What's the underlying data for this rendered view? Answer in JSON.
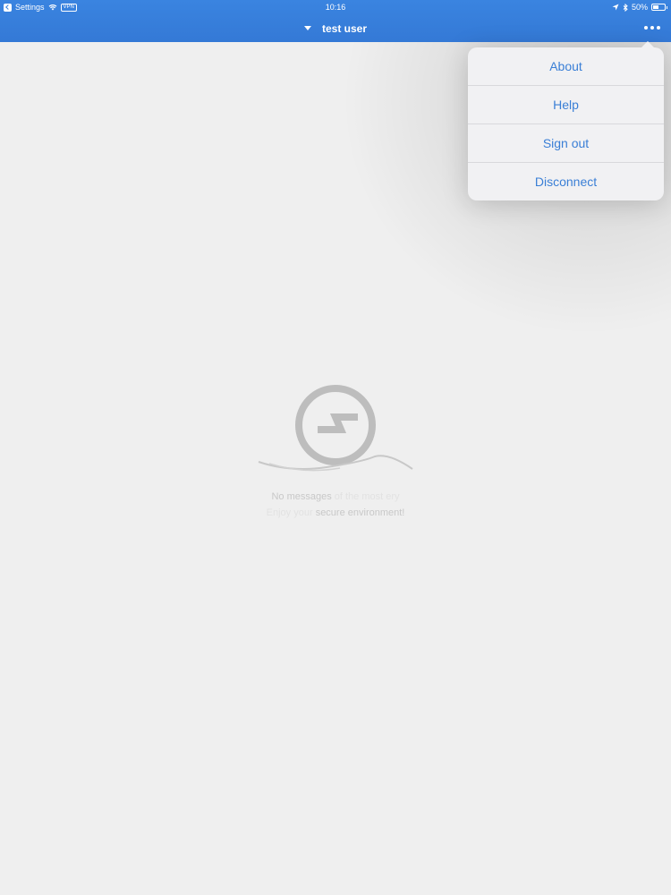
{
  "status_bar": {
    "back_app": "Settings",
    "vpn": "VPN",
    "time": "10:16",
    "battery_percent": "50%"
  },
  "nav": {
    "title": "test user"
  },
  "menu": {
    "items": [
      {
        "label": "About"
      },
      {
        "label": "Help"
      },
      {
        "label": "Sign out"
      },
      {
        "label": "Disconnect"
      }
    ]
  },
  "empty_state": {
    "line1_part1": "No messages",
    "line1_part2": "of the most ery",
    "line2_part1": "Enjoy your",
    "line2_part2": "secure environment!"
  },
  "colors": {
    "accent": "#3a84e0",
    "menu_text": "#3a7fd6",
    "background": "#efefef"
  }
}
